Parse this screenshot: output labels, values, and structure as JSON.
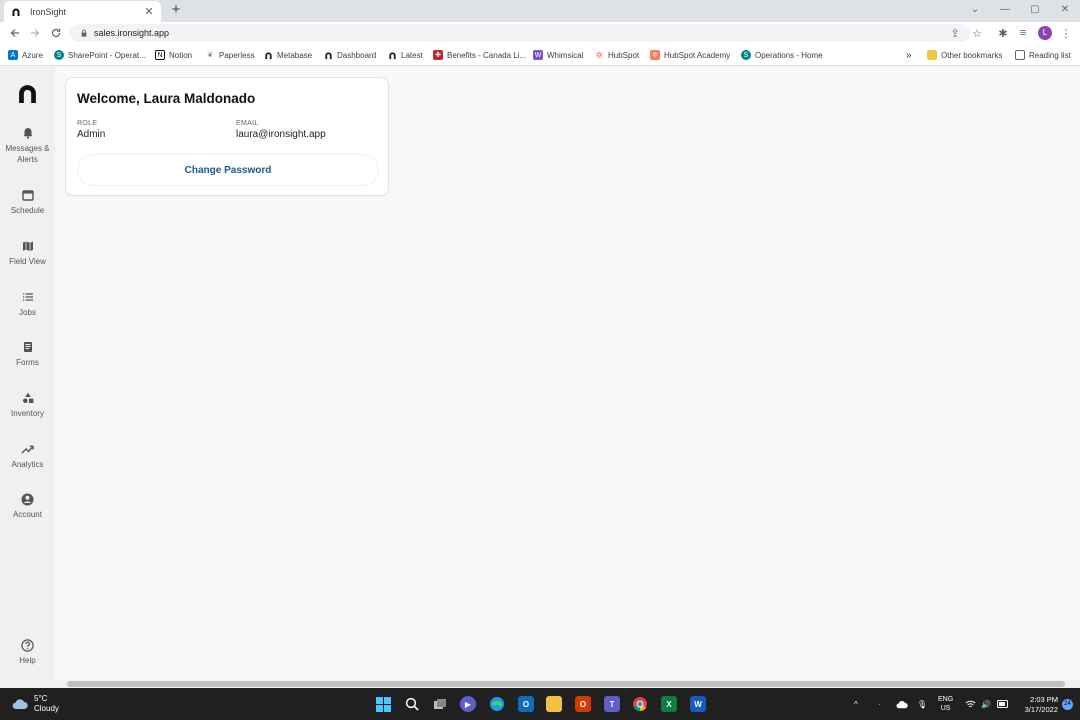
{
  "browser": {
    "tab_title": "IronSight",
    "url": "sales.ironsight.app",
    "profile_initial": "L",
    "bookmarks": [
      {
        "label": "Azure",
        "icon": "azure-icon",
        "color": "#0078d4"
      },
      {
        "label": "SharePoint - Operat...",
        "icon": "sharepoint-icon",
        "color": "#038387"
      },
      {
        "label": "Notion",
        "icon": "notion-icon",
        "color": "#111111"
      },
      {
        "label": "Paperless",
        "icon": "paperless-icon",
        "color": "#6b8e5a"
      },
      {
        "label": "Metabase",
        "icon": "ironsight-icon",
        "color": "#222222"
      },
      {
        "label": "Dashboard",
        "icon": "ironsight-icon",
        "color": "#222222"
      },
      {
        "label": "Latest",
        "icon": "ironsight-icon",
        "color": "#222222"
      },
      {
        "label": "Benefits - Canada Li...",
        "icon": "benefits-icon",
        "color": "#c4262e"
      },
      {
        "label": "Whimsical",
        "icon": "whimsical-icon",
        "color": "#7b4fd1"
      },
      {
        "label": "HubSpot",
        "icon": "hubspot-icon",
        "color": "#ff7a59"
      },
      {
        "label": "HubSpot Academy",
        "icon": "hubspot-academy-icon",
        "color": "#ff7a59"
      },
      {
        "label": "Operations - Home",
        "icon": "sharepoint-icon",
        "color": "#038387"
      }
    ],
    "more_bookmarks": "»",
    "other_bookmarks": "Other bookmarks",
    "reading_list": "Reading list"
  },
  "sidebar": {
    "items": [
      {
        "label": "Messages & Alerts",
        "icon": "bell-icon"
      },
      {
        "label": "Schedule",
        "icon": "calendar-icon"
      },
      {
        "label": "Field View",
        "icon": "map-icon"
      },
      {
        "label": "Jobs",
        "icon": "list-icon"
      },
      {
        "label": "Forms",
        "icon": "form-icon"
      },
      {
        "label": "Inventory",
        "icon": "shapes-icon"
      },
      {
        "label": "Analytics",
        "icon": "trending-icon"
      },
      {
        "label": "Account",
        "icon": "account-icon"
      }
    ],
    "help_label": "Help"
  },
  "account": {
    "welcome": "Welcome, Laura Maldonado",
    "role_label": "ROLE",
    "role_value": "Admin",
    "email_label": "EMAIL",
    "email_value": "laura@ironsight.app",
    "change_password": "Change Password"
  },
  "taskbar": {
    "temp": "5°C",
    "condition": "Cloudy",
    "lang_top": "ENG",
    "lang_bottom": "US",
    "time": "2:03 PM",
    "date": "3/17/2022",
    "notifications": "24"
  }
}
